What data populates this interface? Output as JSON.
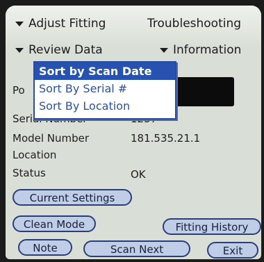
{
  "menus": {
    "adjust_fitting": "Adjust Fitting",
    "troubleshooting": "Troubleshooting",
    "review_data": "Review Data",
    "information": "Information"
  },
  "dropdown": {
    "items": [
      "Sort by Scan Date",
      "Sort By Serial #",
      "Sort By Location"
    ],
    "selected_index": 0
  },
  "fields": {
    "po_label": "Po",
    "serial_label": "Serial Number",
    "serial_value": "1237",
    "model_label": "Model Number",
    "model_value": "181.535.21.1",
    "location_label": "Location",
    "status_label": "Status",
    "status_value": "OK"
  },
  "buttons": {
    "current_settings": "Current Settings",
    "clean_mode": "Clean Mode",
    "fitting_history": "Fitting History",
    "note": "Note",
    "scan_next": "Scan Next",
    "exit": "Exit"
  }
}
